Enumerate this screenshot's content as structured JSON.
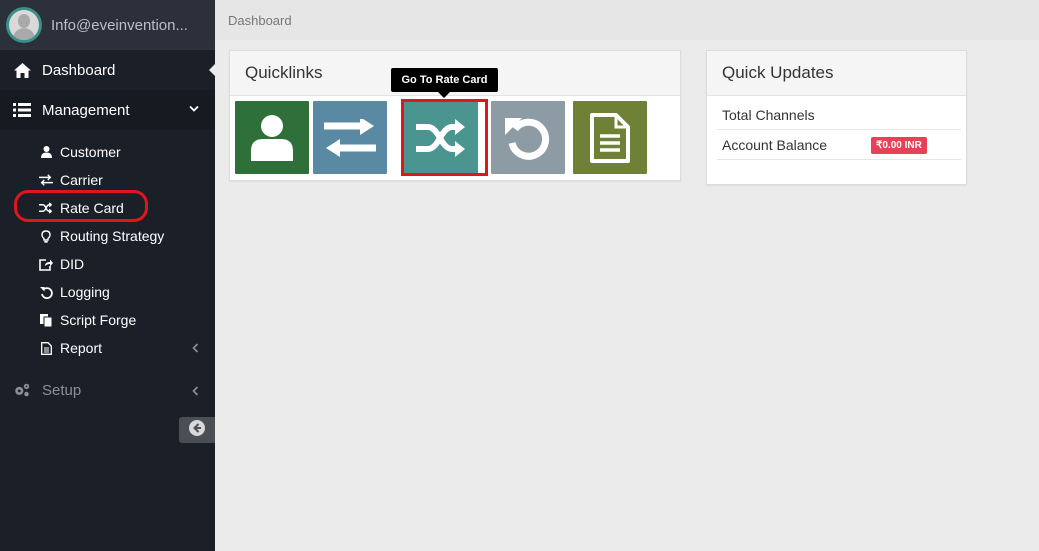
{
  "user": {
    "email": "Info@eveinvention..."
  },
  "sidebar": {
    "dashboard_label": "Dashboard",
    "management_label": "Management",
    "submenu": [
      {
        "label": "Customer",
        "icon": "user-icon"
      },
      {
        "label": "Carrier",
        "icon": "exchange-icon"
      },
      {
        "label": "Rate Card",
        "icon": "shuffle-icon"
      },
      {
        "label": "Routing Strategy",
        "icon": "lightbulb-icon"
      },
      {
        "label": "DID",
        "icon": "share-icon"
      },
      {
        "label": "Logging",
        "icon": "undo-icon"
      },
      {
        "label": "Script Forge",
        "icon": "copy-icon"
      },
      {
        "label": "Report",
        "icon": "file-text-icon"
      }
    ],
    "setup_label": "Setup"
  },
  "breadcrumb": {
    "current": "Dashboard"
  },
  "quicklinks": {
    "title": "Quicklinks",
    "tooltip": "Go To Rate Card",
    "tiles": [
      {
        "name": "customer",
        "icon": "user-icon",
        "color": "#2f6f3a"
      },
      {
        "name": "carrier",
        "icon": "exchange-icon",
        "color": "#5a8aa3"
      },
      {
        "name": "rate-card",
        "icon": "shuffle-icon",
        "color": "#4a9590"
      },
      {
        "name": "logging",
        "icon": "undo-icon",
        "color": "#8c9ba4"
      },
      {
        "name": "report",
        "icon": "file-text-icon",
        "color": "#6e8136"
      }
    ]
  },
  "quick_updates": {
    "title": "Quick Updates",
    "total_channels_label": "Total Channels",
    "account_balance_label": "Account Balance",
    "account_balance_value": "₹0.00 INR"
  },
  "colors": {
    "sidebar_bg": "#1b1f27",
    "highlight": "#e0161e",
    "badge": "#e84057"
  }
}
